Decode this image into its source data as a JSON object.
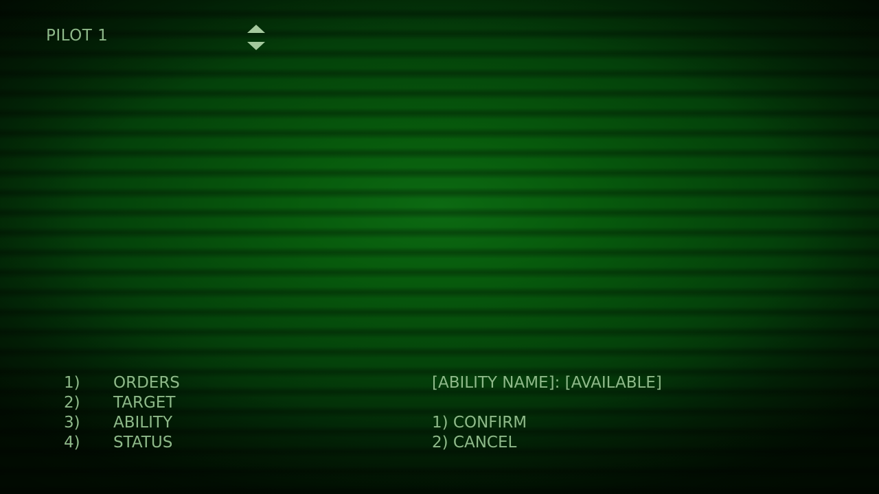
{
  "header": {
    "pilot_label": "PILOT 1"
  },
  "menu": {
    "items": [
      {
        "number": "1)",
        "label": "ORDERS"
      },
      {
        "number": "2)",
        "label": "TARGET"
      },
      {
        "number": "3)",
        "label": "ABILITY"
      },
      {
        "number": "4)",
        "label": "STATUS"
      }
    ]
  },
  "ability_panel": {
    "status_line": "[ABILITY NAME]: [AVAILABLE]",
    "options": [
      {
        "label": "1) CONFIRM"
      },
      {
        "label": "2) CANCEL"
      }
    ]
  },
  "icons": {
    "switcher_up": "triangle-up-icon",
    "switcher_down": "triangle-down-icon"
  },
  "colors": {
    "text": "#8fb98a",
    "background_center": "#0c6a12",
    "background_edge": "#011202",
    "arrow": "#a4c99d"
  }
}
